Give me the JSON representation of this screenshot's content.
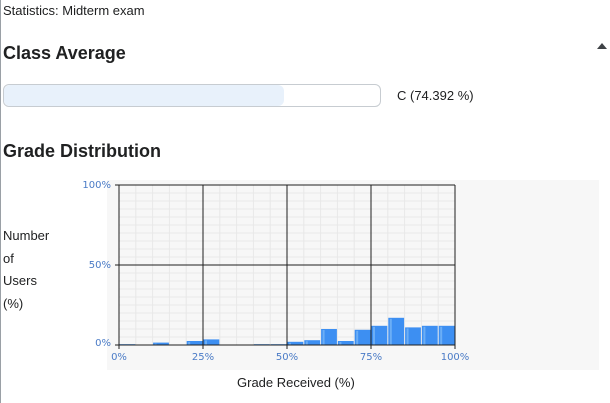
{
  "header": {
    "breadcrumb": "Statistics: Midterm exam"
  },
  "class_average": {
    "heading": "Class Average",
    "value_text": "C (74.392 %)",
    "percent": 74.392
  },
  "grade_distribution": {
    "heading": "Grade Distribution",
    "ylabel_lines": [
      "Number",
      "of",
      "Users",
      "(%)"
    ],
    "xlabel": "Grade Received (%)"
  },
  "colors": {
    "bar": "#3d8ff2",
    "bar_light": "#7fbaf8",
    "grid_major": "#1f1f1f",
    "grid_minor": "#e8e8e8",
    "plot_bg": "#f7f7f7",
    "tick_text": "#4a7bc6"
  },
  "chart_data": {
    "type": "bar",
    "xlim": [
      0,
      100
    ],
    "ylim": [
      0,
      100
    ],
    "xticks": [
      "0%",
      "25%",
      "50%",
      "75%",
      "100%"
    ],
    "yticks": [
      "0%",
      "50%",
      "100%"
    ],
    "bin_width": 5,
    "x": [
      0,
      5,
      10,
      15,
      20,
      25,
      30,
      35,
      40,
      45,
      50,
      55,
      60,
      65,
      70,
      75,
      80,
      85,
      90,
      95
    ],
    "values": [
      0.5,
      0,
      1.5,
      0,
      2.5,
      3.5,
      0,
      0,
      0.5,
      0.5,
      2,
      3,
      10,
      2.5,
      9.5,
      12,
      17,
      11,
      12,
      12
    ],
    "grid": true
  }
}
